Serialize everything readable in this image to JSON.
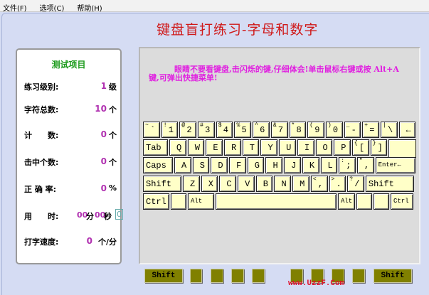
{
  "menu": [
    "文件(F)",
    "选项(C)",
    "帮助(H)"
  ],
  "title": "键盘盲打练习-字母和数字",
  "panel": {
    "title": "测试项目",
    "stats": [
      {
        "label": "练习级别:",
        "value": "1",
        "unit": "级"
      },
      {
        "label": "字符总数:",
        "value": "10",
        "unit": "个"
      },
      {
        "label": "计　　数:",
        "value": "0",
        "unit": "个"
      },
      {
        "label": "击中个数:",
        "value": "0",
        "unit": "个"
      },
      {
        "label": "正 确 率:",
        "value": "0",
        "unit": "%"
      },
      {
        "label": "打字速度:",
        "value": "0",
        "unit": "个/分"
      }
    ],
    "time": {
      "label": "用　　时:",
      "minutes": "00",
      "min_unit": "分",
      "seconds": "00",
      "sec_unit": "秒",
      "box": "0"
    }
  },
  "hint": "眼睛不要看键盘,击闪烁的键,仔细体会!单击鼠标右键或按 Alt+A 键,可弹出快捷菜单!",
  "rows": [
    [
      {
        "s": "~",
        "m": "`"
      },
      {
        "s": "!",
        "m": "1"
      },
      {
        "s": "@",
        "m": "2"
      },
      {
        "s": "#",
        "m": "3"
      },
      {
        "s": "$",
        "m": "4"
      },
      {
        "s": "%",
        "m": "5"
      },
      {
        "s": "^",
        "m": "6"
      },
      {
        "s": "&",
        "m": "7"
      },
      {
        "s": "*",
        "m": "8"
      },
      {
        "s": "(",
        "m": "9"
      },
      {
        "s": ")",
        "m": "0"
      },
      {
        "s": "_",
        "m": "-"
      },
      {
        "s": "+",
        "m": "="
      },
      {
        "s": "|",
        "m": "\\"
      },
      {
        "s": "",
        "m": "←"
      }
    ],
    [
      {
        "m": "Tab",
        "c": "lbl w35"
      },
      {
        "m": "Q"
      },
      {
        "m": "W"
      },
      {
        "m": "E"
      },
      {
        "m": "R"
      },
      {
        "m": "T"
      },
      {
        "m": "Y"
      },
      {
        "m": "U"
      },
      {
        "m": "I"
      },
      {
        "m": "O"
      },
      {
        "m": "P"
      },
      {
        "s": "{",
        "m": "["
      },
      {
        "s": "}",
        "m": "]"
      }
    ],
    [
      {
        "m": "Caps",
        "c": "lbl w42"
      },
      {
        "m": "A"
      },
      {
        "m": "S"
      },
      {
        "m": "D"
      },
      {
        "m": "F"
      },
      {
        "m": "G"
      },
      {
        "m": "H"
      },
      {
        "m": "J"
      },
      {
        "m": "K"
      },
      {
        "m": "L"
      },
      {
        "s": ":",
        "m": ";"
      },
      {
        "s": "\"",
        "m": ","
      },
      {
        "m": "Enter←",
        "c": "lbl small w56"
      }
    ],
    [
      {
        "m": "Shift",
        "c": "lbl w54"
      },
      {
        "m": "Z"
      },
      {
        "m": "X"
      },
      {
        "m": "C"
      },
      {
        "m": "V"
      },
      {
        "m": "B"
      },
      {
        "m": "N"
      },
      {
        "m": "M"
      },
      {
        "s": "<",
        "m": ","
      },
      {
        "s": ">",
        "m": "."
      },
      {
        "s": "?",
        "m": "/"
      },
      {
        "m": "Shift",
        "c": "lbl w68"
      }
    ],
    [
      {
        "m": "Ctrl",
        "c": "lbl w37"
      },
      {
        "m": "",
        "c": "w22"
      },
      {
        "m": "Alt",
        "c": "lbl small w37"
      },
      {
        "m": "",
        "c": "w170"
      },
      {
        "m": "Alt",
        "c": "lbl small w24"
      },
      {
        "m": "",
        "c": "w22"
      },
      {
        "m": "",
        "c": "w22"
      },
      {
        "m": "Ctrl",
        "c": "lbl small w32"
      }
    ]
  ],
  "shift_label": "Shift",
  "watermark": "www.UzzF.Com"
}
